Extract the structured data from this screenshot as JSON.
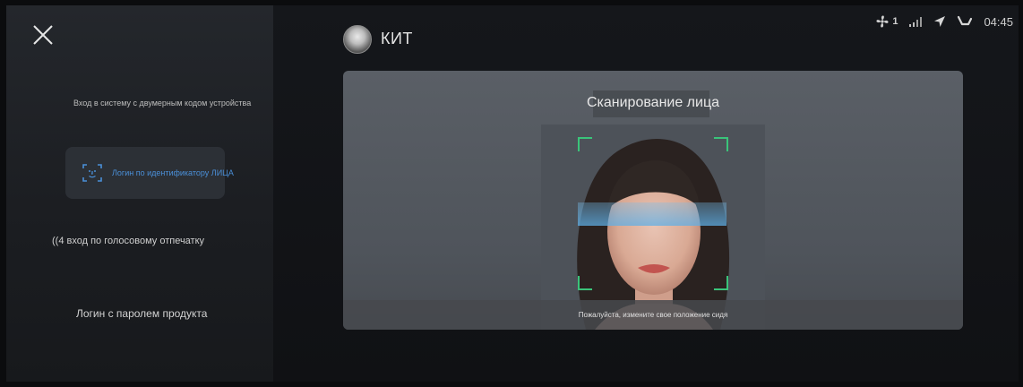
{
  "sidebar": {
    "close_icon": "close-icon",
    "items": [
      {
        "id": "qr",
        "label": "Вход в систему с двумерным кодом устройства"
      },
      {
        "id": "face",
        "label": "Логин по идентификатору ЛИЦА",
        "icon": "face-scan-icon",
        "active": true,
        "color": "#4a8fd8"
      },
      {
        "id": "voice",
        "label": "((4 вход по голосовому отпечатку"
      },
      {
        "id": "password",
        "label": "Логин с паролем продукта"
      }
    ]
  },
  "header": {
    "user_name": "КИТ",
    "avatar_icon": "user-avatar"
  },
  "status_bar": {
    "fan_icon": "fan-icon",
    "fan_level": "1",
    "signal_icon": "signal-icon",
    "location_icon": "location-arrow-icon",
    "seat_icon": "seat-icon",
    "time": "04:45"
  },
  "scan": {
    "title": "Сканирование лица",
    "hint": "Пожалуйста, измените свое положение сидя",
    "frame_color": "#3ac47a"
  }
}
